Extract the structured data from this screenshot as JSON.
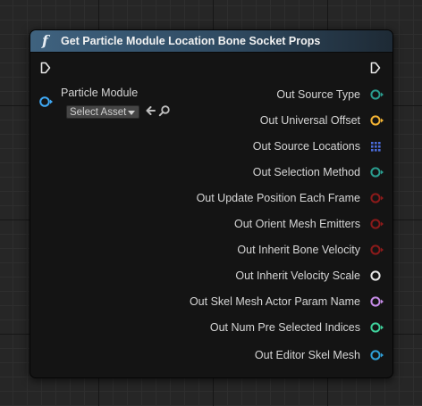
{
  "node": {
    "title": "Get Particle Module Location Bone Socket Props",
    "function_icon": "function-icon"
  },
  "inputs": [
    {
      "label": "Particle Module",
      "pin_color": "#3fa9f5",
      "asset_select": "Select Asset"
    }
  ],
  "outputs": [
    {
      "label": "Out Source Type",
      "pin": "enum",
      "color": "#2a9d8f"
    },
    {
      "label": "Out Universal Offset",
      "pin": "struct",
      "color": "#f2b233"
    },
    {
      "label": "Out Source Locations",
      "pin": "array",
      "color": "#4a6bd8"
    },
    {
      "label": "Out Selection Method",
      "pin": "enum",
      "color": "#2a9d8f"
    },
    {
      "label": "Out Update Position Each Frame",
      "pin": "bool",
      "color": "#8b1a1a"
    },
    {
      "label": "Out Orient Mesh Emitters",
      "pin": "bool",
      "color": "#8b1a1a"
    },
    {
      "label": "Out Inherit Bone Velocity",
      "pin": "bool",
      "color": "#8b1a1a"
    },
    {
      "label": "Out Inherit Velocity Scale",
      "pin": "float",
      "color": "#e6e6e6"
    },
    {
      "label": "Out Skel Mesh Actor Param Name",
      "pin": "name",
      "color": "#c58be6"
    },
    {
      "label": "Out Num Pre Selected Indices",
      "pin": "int",
      "color": "#3ecf9a"
    },
    {
      "label": "Out Editor Skel Mesh",
      "pin": "object",
      "color": "#2f9fd8"
    }
  ]
}
